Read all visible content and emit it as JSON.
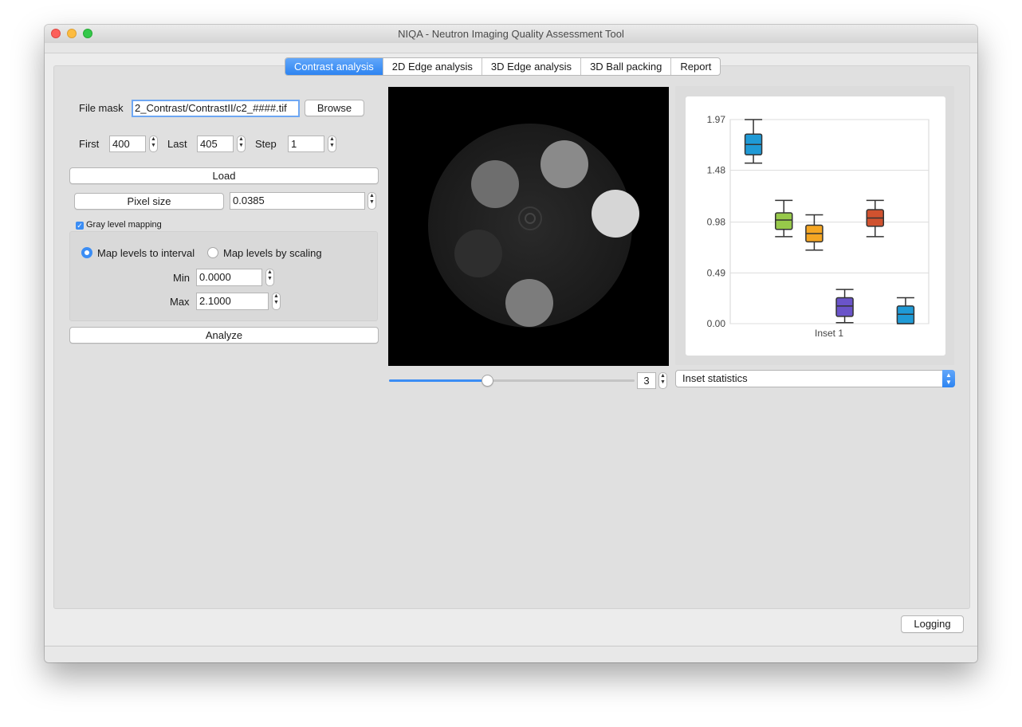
{
  "window": {
    "title": "NIQA - Neutron Imaging Quality Assessment Tool"
  },
  "tabs": [
    {
      "label": "Contrast analysis",
      "active": true
    },
    {
      "label": "2D Edge analysis",
      "active": false
    },
    {
      "label": "3D Edge analysis",
      "active": false
    },
    {
      "label": "3D Ball packing",
      "active": false
    },
    {
      "label": "Report",
      "active": false
    }
  ],
  "form": {
    "file_mask_label": "File mask",
    "file_mask_value": "2_Contrast/ContrastII/c2_####.tif",
    "browse_label": "Browse",
    "first_label": "First",
    "first_value": "400",
    "last_label": "Last",
    "last_value": "405",
    "step_label": "Step",
    "step_value": "1",
    "load_label": "Load",
    "pixel_size_label": "Pixel size",
    "pixel_size_value": "0.0385",
    "gray_level_label": "Gray level mapping",
    "gray_level_checked": true,
    "map_interval_label": "Map levels to interval",
    "map_scaling_label": "Map levels by scaling",
    "map_mode": "interval",
    "min_label": "Min",
    "min_value": "0.0000",
    "max_label": "Max",
    "max_value": "2.1000",
    "analyze_label": "Analyze"
  },
  "viewer": {
    "slice_value": "3",
    "slider_fraction": 0.4
  },
  "stats_combo": {
    "selected": "Inset statistics"
  },
  "logging_label": "Logging",
  "colors": {
    "accent": "#3b8df4",
    "box_blue": "#1f9ad6",
    "box_green": "#97c94a",
    "box_orange": "#f5a623",
    "box_red": "#d0522f",
    "box_purple": "#6a54c9"
  },
  "chart_data": {
    "type": "box",
    "categories": [
      "Inset 1"
    ],
    "y_ticks": [
      "1.97",
      "1.48",
      "0.98",
      "0.49",
      "0.00"
    ],
    "ylim": [
      0,
      1.97
    ],
    "series": [
      {
        "color": "#1f9ad6",
        "min": 1.55,
        "q1": 1.63,
        "median": 1.73,
        "q3": 1.83,
        "max": 1.97
      },
      {
        "color": "#97c94a",
        "min": 0.84,
        "q1": 0.91,
        "median": 1.0,
        "q3": 1.07,
        "max": 1.19
      },
      {
        "color": "#f5a623",
        "min": 0.71,
        "q1": 0.79,
        "median": 0.87,
        "q3": 0.95,
        "max": 1.05
      },
      {
        "color": "#6a54c9",
        "min": 0.01,
        "q1": 0.07,
        "median": 0.17,
        "q3": 0.25,
        "max": 0.33
      },
      {
        "color": "#d0522f",
        "min": 0.84,
        "q1": 0.94,
        "median": 1.02,
        "q3": 1.1,
        "max": 1.19
      },
      {
        "color": "#1f9ad6",
        "min": 0.0,
        "q1": 0.0,
        "median": 0.09,
        "q3": 0.17,
        "max": 0.25
      }
    ]
  }
}
